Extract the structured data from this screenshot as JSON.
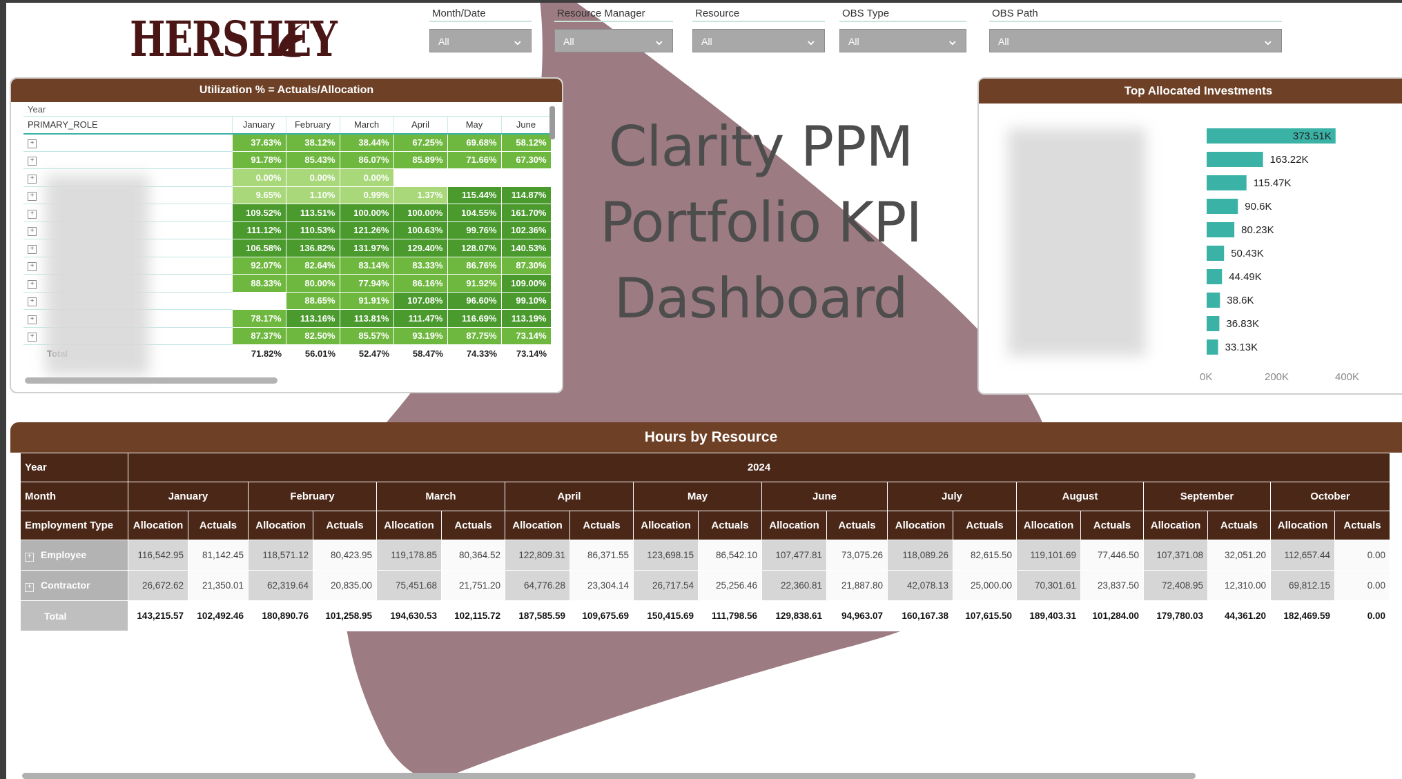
{
  "brand": {
    "logo_text": "HERSHEY"
  },
  "colors": {
    "brand_brown": "#6e4127",
    "dark_header": "#4a2717",
    "teal_bar": "#3ab3a6",
    "overlay_mauve": "#9c7b82",
    "green_dark": "#4a9a2e",
    "green_mid": "#6fb83f",
    "green_light": "#a8d87a"
  },
  "filters": [
    {
      "label": "Month/Date",
      "value": "All"
    },
    {
      "label": "Resource Manager",
      "value": "All"
    },
    {
      "label": "Resource",
      "value": "All"
    },
    {
      "label": "OBS Type",
      "value": "All"
    },
    {
      "label": "OBS Path",
      "value": "All"
    }
  ],
  "title_overlay": {
    "line1": "Clarity PPM",
    "line2": "Portfolio KPI",
    "line3": "Dashboard"
  },
  "utilization": {
    "title": "Utilization % = Actuals/Allocation",
    "level_year": "Year",
    "row_header": "PRIMARY_ROLE",
    "months": [
      "January",
      "February",
      "March",
      "April",
      "May",
      "June"
    ],
    "rows": [
      [
        "37.63%",
        "38.12%",
        "38.44%",
        "67.25%",
        "69.68%",
        "58.12%"
      ],
      [
        "91.78%",
        "85.43%",
        "86.07%",
        "85.89%",
        "71.66%",
        "67.30%"
      ],
      [
        "0.00%",
        "0.00%",
        "0.00%",
        "",
        "",
        ""
      ],
      [
        "9.65%",
        "1.10%",
        "0.99%",
        "1.37%",
        "115.44%",
        "114.87%"
      ],
      [
        "109.52%",
        "113.51%",
        "100.00%",
        "100.00%",
        "104.55%",
        "161.70%"
      ],
      [
        "111.12%",
        "110.53%",
        "121.26%",
        "100.63%",
        "99.76%",
        "102.36%"
      ],
      [
        "106.58%",
        "136.82%",
        "131.97%",
        "129.40%",
        "128.07%",
        "140.53%"
      ],
      [
        "92.07%",
        "82.64%",
        "83.14%",
        "83.33%",
        "86.76%",
        "87.30%"
      ],
      [
        "88.33%",
        "80.00%",
        "77.94%",
        "86.16%",
        "91.92%",
        "109.00%"
      ],
      [
        "",
        "88.65%",
        "91.91%",
        "107.08%",
        "96.60%",
        "99.10%"
      ],
      [
        "78.17%",
        "113.16%",
        "113.81%",
        "111.47%",
        "116.69%",
        "113.19%"
      ],
      [
        "87.37%",
        "82.50%",
        "85.57%",
        "93.19%",
        "87.75%",
        "73.14%"
      ]
    ],
    "total_label": "Total",
    "total": [
      "71.82%",
      "56.01%",
      "52.47%",
      "58.47%",
      "74.33%",
      "73.14%"
    ]
  },
  "investments": {
    "title": "Top Allocated Investments",
    "axis_ticks": [
      "0K",
      "200K",
      "400K"
    ]
  },
  "chart_data": {
    "type": "bar",
    "orientation": "horizontal",
    "title": "Top Allocated Investments",
    "categories": [],
    "values": [
      373510,
      163220,
      115470,
      90600,
      80230,
      50430,
      44490,
      38600,
      36830,
      33130
    ],
    "labels": [
      "373.51K",
      "163.22K",
      "115.47K",
      "90.6K",
      "80.23K",
      "50.43K",
      "44.49K",
      "38.6K",
      "36.83K",
      "33.13K"
    ],
    "xlim": [
      0,
      400000
    ],
    "grid": false
  },
  "hours": {
    "title": "Hours by Resource",
    "year_label": "Year",
    "year_value": "2024",
    "month_label": "Month",
    "type_label": "Employment Type",
    "months": [
      "January",
      "February",
      "March",
      "April",
      "May",
      "June",
      "July",
      "August",
      "September",
      "October"
    ],
    "col_alloc": "Allocation",
    "col_actual": "Actuals",
    "rows": [
      {
        "label": "Employee",
        "values": [
          "116,542.95",
          "81,142.45",
          "118,571.12",
          "80,423.95",
          "119,178.85",
          "80,364.52",
          "122,809.31",
          "86,371.55",
          "123,698.15",
          "86,542.10",
          "107,477.81",
          "73,075.26",
          "118,089.26",
          "82,615.50",
          "119,101.69",
          "77,446.50",
          "107,371.08",
          "32,051.20",
          "112,657.44",
          "0.00"
        ]
      },
      {
        "label": "Contractor",
        "values": [
          "26,672.62",
          "21,350.01",
          "62,319.64",
          "20,835.00",
          "75,451.68",
          "21,751.20",
          "64,776.28",
          "23,304.14",
          "26,717.54",
          "25,256.46",
          "22,360.81",
          "21,887.80",
          "42,078.13",
          "25,000.00",
          "70,301.61",
          "23,837.50",
          "72,408.95",
          "12,310.00",
          "69,812.15",
          "0.00"
        ]
      }
    ],
    "total_label": "Total",
    "total": [
      "143,215.57",
      "102,492.46",
      "180,890.76",
      "101,258.95",
      "194,630.53",
      "102,115.72",
      "187,585.59",
      "109,675.69",
      "150,415.69",
      "111,798.56",
      "129,838.61",
      "94,963.07",
      "160,167.38",
      "107,615.50",
      "189,403.31",
      "101,284.00",
      "179,780.03",
      "44,361.20",
      "182,469.59",
      "0.00"
    ]
  }
}
